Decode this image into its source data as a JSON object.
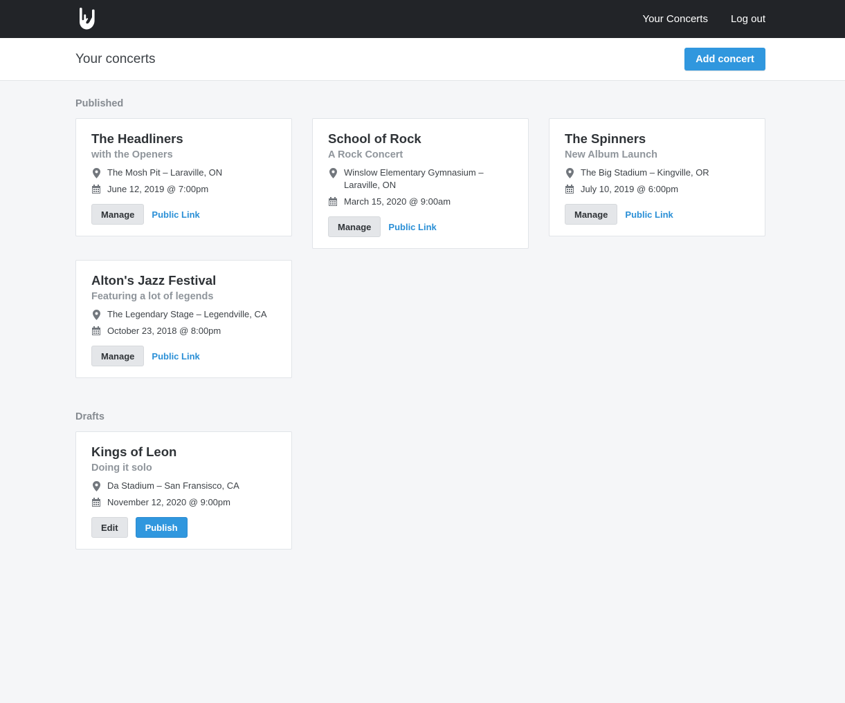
{
  "nav": {
    "logo_icon": "rock-hand-icon",
    "links": [
      "Your Concerts",
      "Log out"
    ]
  },
  "header": {
    "title": "Your concerts",
    "add_button": "Add concert"
  },
  "colors": {
    "topbar": "#222428",
    "accent": "#3097de",
    "link": "#2a8fd6",
    "background": "#f5f6f8"
  },
  "sections": {
    "published": {
      "heading": "Published",
      "concerts": [
        {
          "title": "The Headliners",
          "subtitle": "with the Openers",
          "location": "The Mosh Pit – Laraville, ON",
          "date": "June 12, 2019 @ 7:00pm",
          "primary_action": "Manage",
          "secondary_action": "Public Link"
        },
        {
          "title": "School of Rock",
          "subtitle": "A Rock Concert",
          "location": "Winslow Elementary Gymnasium – Laraville, ON",
          "date": "March 15, 2020 @ 9:00am",
          "primary_action": "Manage",
          "secondary_action": "Public Link"
        },
        {
          "title": "The Spinners",
          "subtitle": "New Album Launch",
          "location": "The Big Stadium – Kingville, OR",
          "date": "July 10, 2019 @ 6:00pm",
          "primary_action": "Manage",
          "secondary_action": "Public Link"
        },
        {
          "title": "Alton's Jazz Festival",
          "subtitle": "Featuring a lot of legends",
          "location": "The Legendary Stage – Legendville, CA",
          "date": "October 23, 2018 @ 8:00pm",
          "primary_action": "Manage",
          "secondary_action": "Public Link"
        }
      ]
    },
    "drafts": {
      "heading": "Drafts",
      "concerts": [
        {
          "title": "Kings of Leon",
          "subtitle": "Doing it solo",
          "location": "Da Stadium – San Fransisco, CA",
          "date": "November 12, 2020 @ 9:00pm",
          "primary_action": "Edit",
          "secondary_action": "Publish"
        }
      ]
    }
  }
}
